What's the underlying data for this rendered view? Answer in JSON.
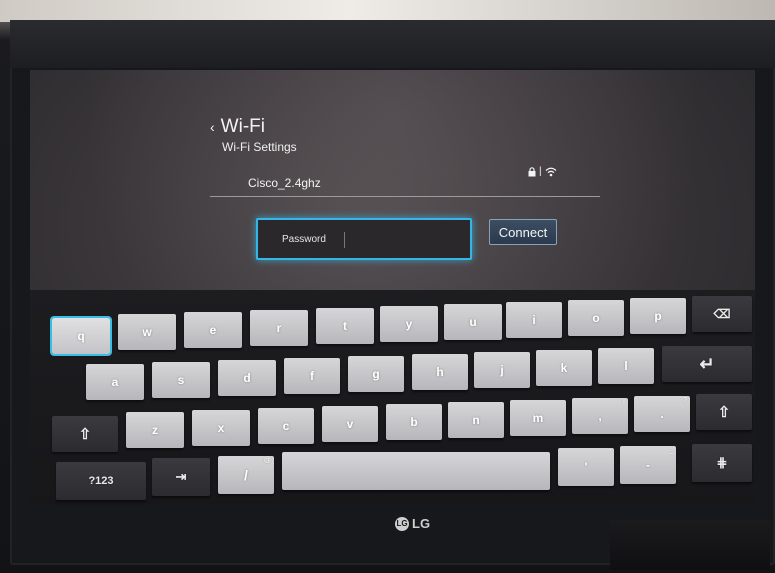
{
  "header": {
    "title": "Wi-Fi",
    "subtitle": "Wi-Fi Settings"
  },
  "network": {
    "ssid": "Cisco_2.4ghz",
    "status_icons": [
      "lock-icon",
      "wifi-icon"
    ]
  },
  "password": {
    "label": "Password",
    "value": ""
  },
  "connect_button": {
    "label": "Connect"
  },
  "keyboard": {
    "row1": [
      "q",
      "w",
      "e",
      "r",
      "t",
      "y",
      "u",
      "i",
      "o",
      "p",
      "⌫"
    ],
    "row2": [
      "a",
      "s",
      "d",
      "f",
      "g",
      "h",
      "j",
      "k",
      "l",
      "↵"
    ],
    "row3": [
      "⇧",
      "z",
      "x",
      "c",
      "v",
      "b",
      "n",
      "m",
      ",",
      ".",
      "⇧"
    ],
    "row4": [
      "?123",
      "⇥",
      "/",
      "",
      "'",
      "-",
      "⋕"
    ],
    "hints": {
      "slash": "@",
      "comma": "!",
      "period": "?",
      "apostrophe": "\"",
      "dash": "_"
    }
  },
  "brand": {
    "logo_mark": "LG",
    "name": "LG"
  },
  "colors": {
    "focus": "#34b7e8"
  }
}
